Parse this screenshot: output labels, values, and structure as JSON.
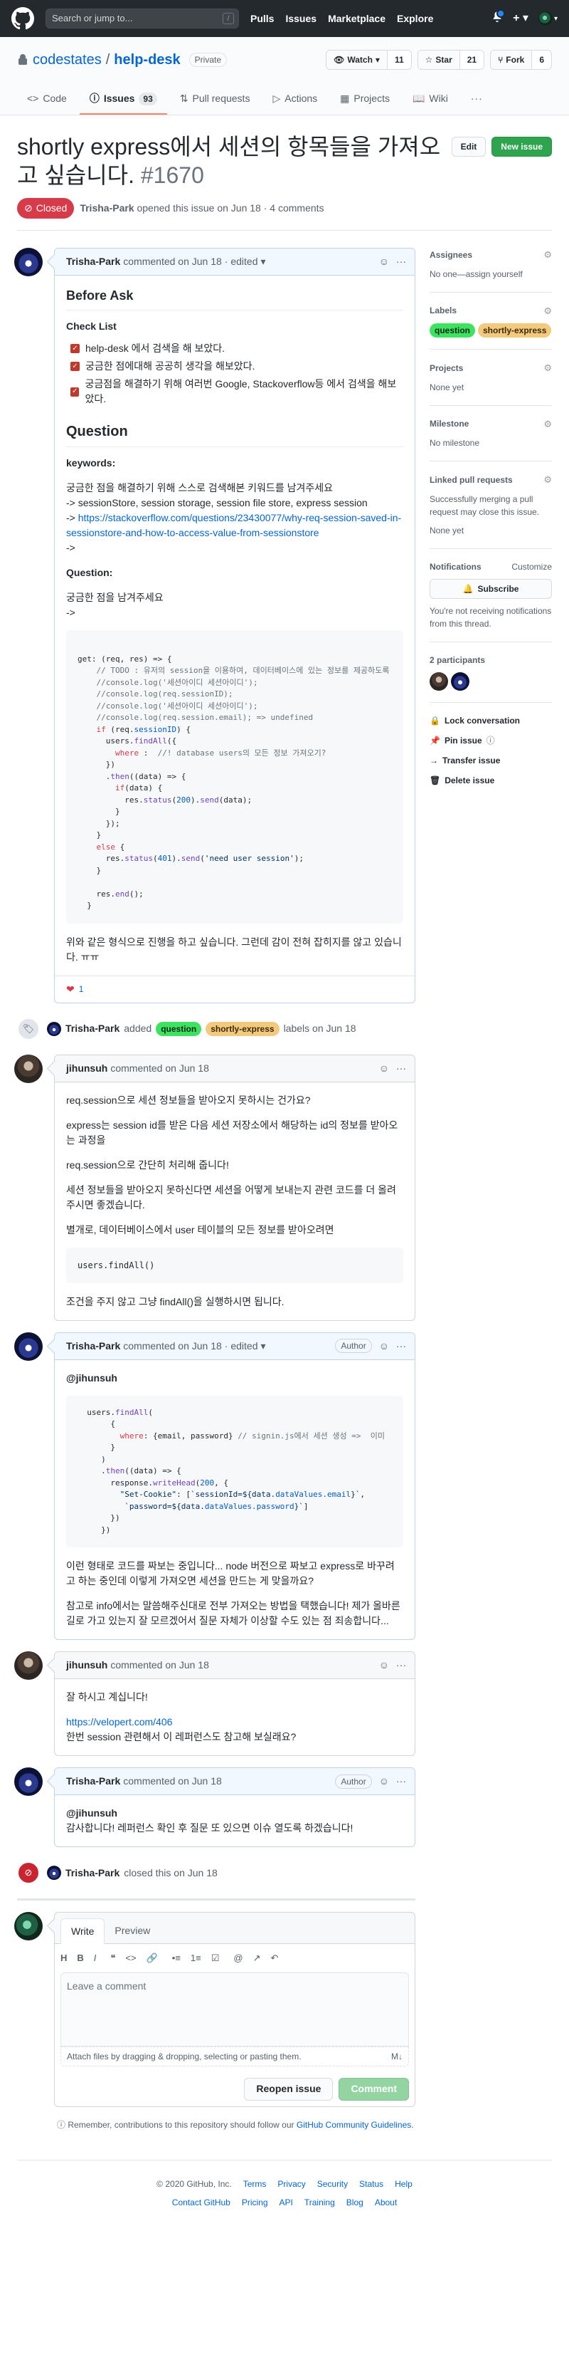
{
  "header": {
    "search_placeholder": "Search or jump to...",
    "search_key": "/",
    "nav": [
      "Pulls",
      "Issues",
      "Marketplace",
      "Explore"
    ]
  },
  "repo": {
    "owner": "codestates",
    "name": "help-desk",
    "visibility": "Private",
    "watch_label": "Watch",
    "watch_count": "11",
    "star_label": "Star",
    "star_count": "21",
    "fork_label": "Fork",
    "fork_count": "6",
    "tabs": [
      {
        "label": "Code",
        "icon": "code-icon"
      },
      {
        "label": "Issues",
        "count": "93",
        "icon": "issue-icon"
      },
      {
        "label": "Pull requests",
        "icon": "pr-icon"
      },
      {
        "label": "Actions",
        "icon": "play-icon"
      },
      {
        "label": "Projects",
        "icon": "project-icon"
      },
      {
        "label": "Wiki",
        "icon": "book-icon"
      }
    ]
  },
  "issue": {
    "title": "shortly express에서 세션의 항목들을 가져오고 싶습니다.",
    "number": "#1670",
    "edit_label": "Edit",
    "new_issue_label": "New issue",
    "state": "Closed",
    "author": "Trisha-Park",
    "meta": "opened this issue on Jun 18 · 4 comments"
  },
  "comments": {
    "c1": {
      "author": "Trisha-Park",
      "date": "commented on Jun 18",
      "edited": "· edited",
      "h_before": "Before Ask",
      "h_checklist": "Check List",
      "checks": [
        "help-desk 에서 검색을 해 보았다.",
        "궁금한 점에대해 공공히 생각을 해보았다.",
        "궁금점을 해결하기 위해 여러번 Google, Stackoverflow등 에서 검색을 해보았다."
      ],
      "h_question": "Question",
      "kw_label": "keywords:",
      "kw_intro": "궁금한 점을 해결하기 위해 스스로 검색해본 키워드를 남겨주세요",
      "kw_line": "-> sessionStore, session storage, session file store, express session",
      "kw_link_prefix": "-> ",
      "kw_link": "https://stackoverflow.com/questions/23430077/why-req-session-saved-in-sessionstore-and-how-to-access-value-from-sessionstore",
      "kw_arrow": "->",
      "q_label": "Question:",
      "q_intro": "궁금한 점을 남겨주세요",
      "q_arrow": "->",
      "outro": "위와 같은 형식으로 진행을 하고 싶습니다. 그런데 감이 전혀 잡히지를 않고 있습니다. ㅠㅠ",
      "reaction_count": "1"
    },
    "label_event": {
      "actor": "Trisha-Park",
      "added": "added",
      "labels_suffix": "labels on Jun 18"
    },
    "c2": {
      "author": "jihunsuh",
      "date": "commented on Jun 18",
      "p1": "req.session으로 세션 정보들을 받아오지 못하시는 건가요?",
      "p2": "express는 session id를 받은 다음 세션 저장소에서 해당하는 id의 정보를 받아오는 과정을",
      "p3": "req.session으로 간단히 처리해 줍니다!",
      "p4": "세션 정보들을 받아오지 못하신다면 세션을 어떻게 보내는지 관련 코드를 더 올려주시면 좋겠습니다.",
      "p5": "별개로, 데이터베이스에서 user 테이블의 모든 정보를 받아오려면",
      "code": "users.findAll()",
      "p6": "조건을 주지 않고 그냥 findAll()을 실행하시면 됩니다."
    },
    "c3": {
      "author": "Trisha-Park",
      "date": "commented on Jun 18",
      "edited": "· edited",
      "badge": "Author",
      "mention": "@jihunsuh",
      "p1": "이런 형태로 코드를 짜보는 중입니다... node 버전으로 짜보고 express로 바꾸려고 하는 중인데 이렇게 가져오면 세션을 만드는 게 맞을까요?",
      "p2": "참고로 info에서는 말씀해주신대로 전부 가져오는 방법을 택했습니다! 제가 올바른 길로 가고 있는지 잘 모르겠어서 질문 자체가 이상할 수도 있는 점 죄송합니다..."
    },
    "c4": {
      "author": "jihunsuh",
      "date": "commented on Jun 18",
      "p1": "잘 하시고 계십니다!",
      "link": "https://velopert.com/406",
      "p2": "한번 session 관련해서 이 레퍼런스도 참고해 보실래요?"
    },
    "c5": {
      "author": "Trisha-Park",
      "date": "commented on Jun 18",
      "badge": "Author",
      "mention": "@jihunsuh",
      "p1": "감사합니다! 레퍼런스 확인 후 질문 또 있으면 이슈 열도록 하겠습니다!"
    },
    "close_event": {
      "actor": "Trisha-Park",
      "text": "closed this on Jun 18"
    }
  },
  "new_comment": {
    "write_tab": "Write",
    "preview_tab": "Preview",
    "toolbar": [
      "H",
      "B",
      "I",
      "❝",
      "<>",
      "🔗",
      "•≡",
      "1≡",
      "☑",
      "@",
      "↗",
      "↶"
    ],
    "placeholder": "Leave a comment",
    "attach_text": "Attach files by dragging & dropping, selecting or pasting them.",
    "reopen_label": "Reopen issue",
    "comment_label": "Comment",
    "remember_prefix": "Remember, contributions to this repository should follow our",
    "remember_link": "GitHub Community Guidelines",
    "remember_suffix": "."
  },
  "sidebar": {
    "assignees_h": "Assignees",
    "assignees_v": "No one—assign yourself",
    "labels_h": "Labels",
    "labels": [
      {
        "name": "question",
        "color": "#3ce260"
      },
      {
        "name": "shortly-express",
        "color": "#f2c97d"
      }
    ],
    "projects_h": "Projects",
    "projects_v": "None yet",
    "milestone_h": "Milestone",
    "milestone_v": "No milestone",
    "linked_h": "Linked pull requests",
    "linked_desc": "Successfully merging a pull request may close this issue.",
    "linked_v": "None yet",
    "notif_h": "Notifications",
    "customize": "Customize",
    "subscribe": "Subscribe",
    "notif_desc": "You're not receiving notifications from this thread.",
    "participants_h": "2 participants",
    "lock": "Lock conversation",
    "pin": "Pin issue",
    "transfer": "Transfer issue",
    "delete": "Delete issue"
  },
  "footer": {
    "copyright": "© 2020 GitHub, Inc.",
    "row1": [
      "Terms",
      "Privacy",
      "Security",
      "Status",
      "Help"
    ],
    "row2": [
      "Contact GitHub",
      "Pricing",
      "API",
      "Training",
      "Blog",
      "About"
    ]
  }
}
